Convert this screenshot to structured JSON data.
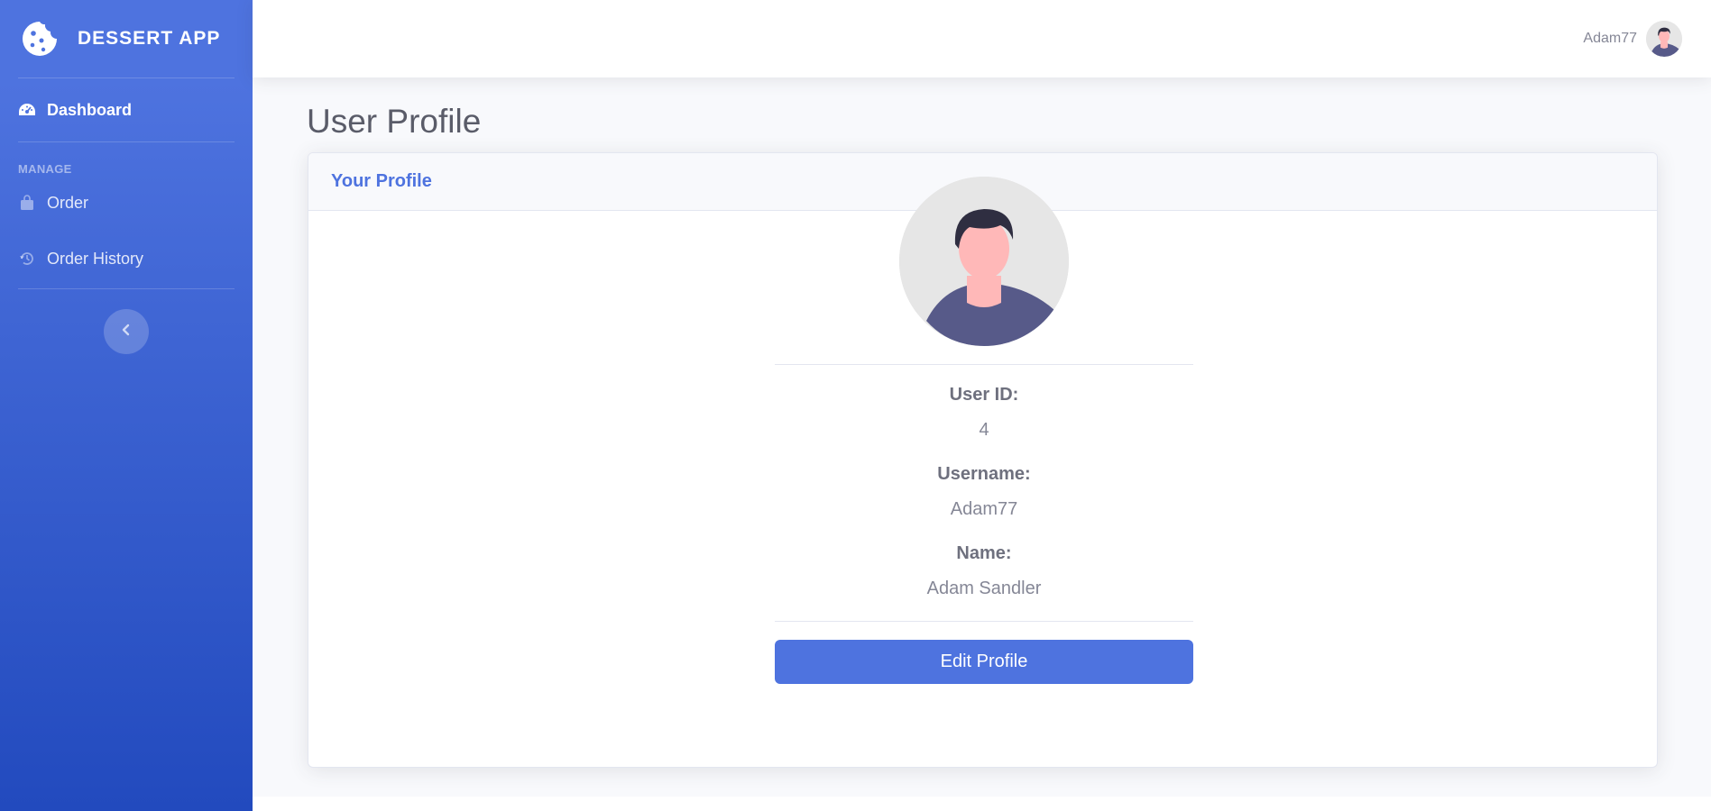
{
  "app": {
    "brand": "DESSERT APP",
    "brand_icon": "cookie-icon"
  },
  "sidebar": {
    "dashboard_label": "Dashboard",
    "manage_heading": "MANAGE",
    "order_label": "Order",
    "order_history_label": "Order History",
    "toggle_icon": "chevron-left-icon"
  },
  "topbar": {
    "username": "Adam77"
  },
  "page": {
    "title": "User Profile"
  },
  "card": {
    "header": "Your Profile",
    "user_id_label": "User ID:",
    "user_id_value": "4",
    "username_label": "Username:",
    "username_value": "Adam77",
    "name_label": "Name:",
    "name_value": "Adam Sandler",
    "edit_button": "Edit Profile"
  },
  "colors": {
    "primary": "#4e73df",
    "primary_dark": "#224abe",
    "text": "#858796"
  }
}
